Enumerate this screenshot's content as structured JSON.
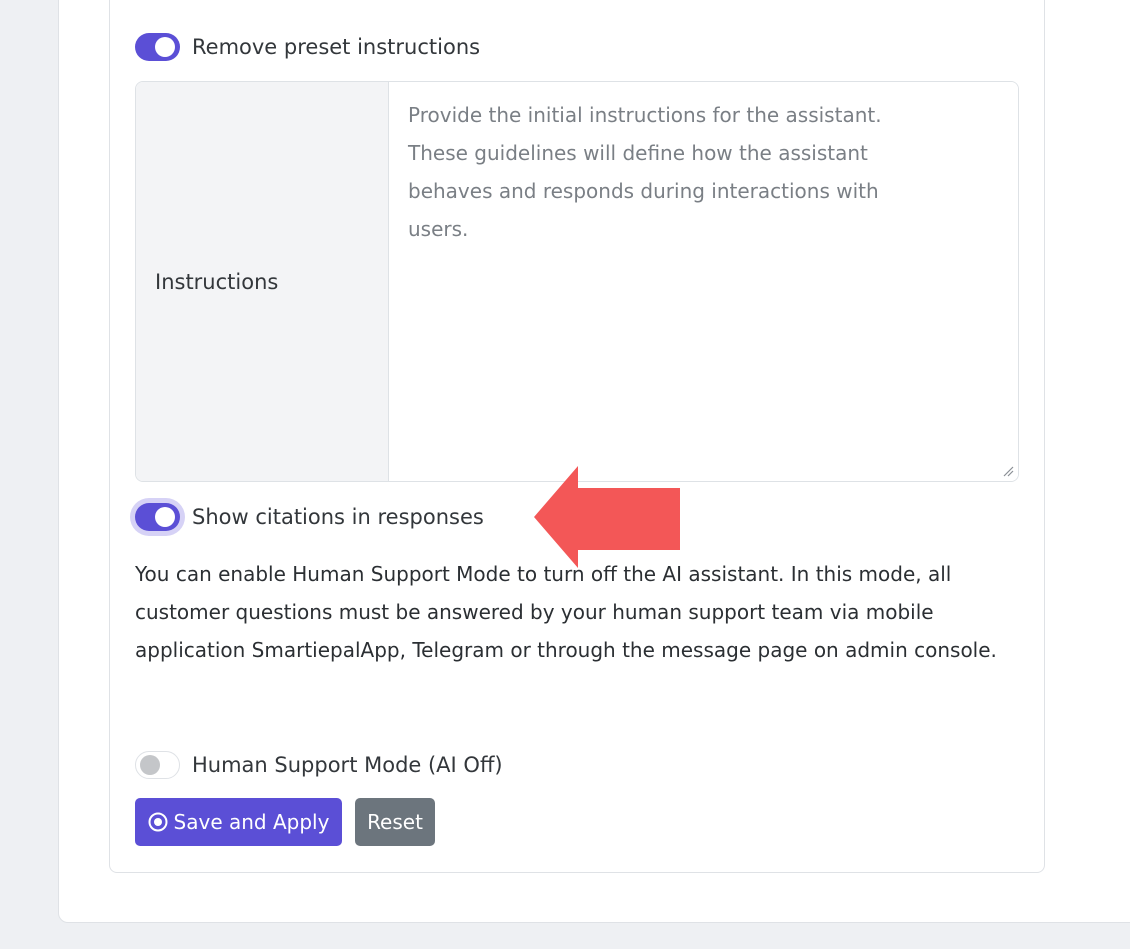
{
  "toggles": {
    "remove_preset": {
      "label": "Remove preset instructions",
      "checked": true
    },
    "show_citations": {
      "label": "Show citations in responses",
      "checked": true
    },
    "human_support": {
      "label": "Human Support Mode (AI Off)",
      "checked": false
    }
  },
  "instructions": {
    "label": "Instructions",
    "placeholder": "Provide the initial instructions for the assistant. These guidelines will define how the assistant behaves and responds during interactions with users.",
    "value": ""
  },
  "description": "You can enable Human Support Mode to turn off the AI assistant. In this mode, all customer questions must be answered by your human support team via mobile application SmartiepalApp, Telegram or through the message page on admin console.",
  "buttons": {
    "save_label": "Save and Apply",
    "reset_label": "Reset"
  },
  "icons": {
    "save_icon": "record-circle-icon",
    "annotation": "red-arrow-left-icon"
  },
  "colors": {
    "accent": "#5b4fd6",
    "secondary": "#6c757d",
    "annotation_arrow": "#f35757"
  }
}
